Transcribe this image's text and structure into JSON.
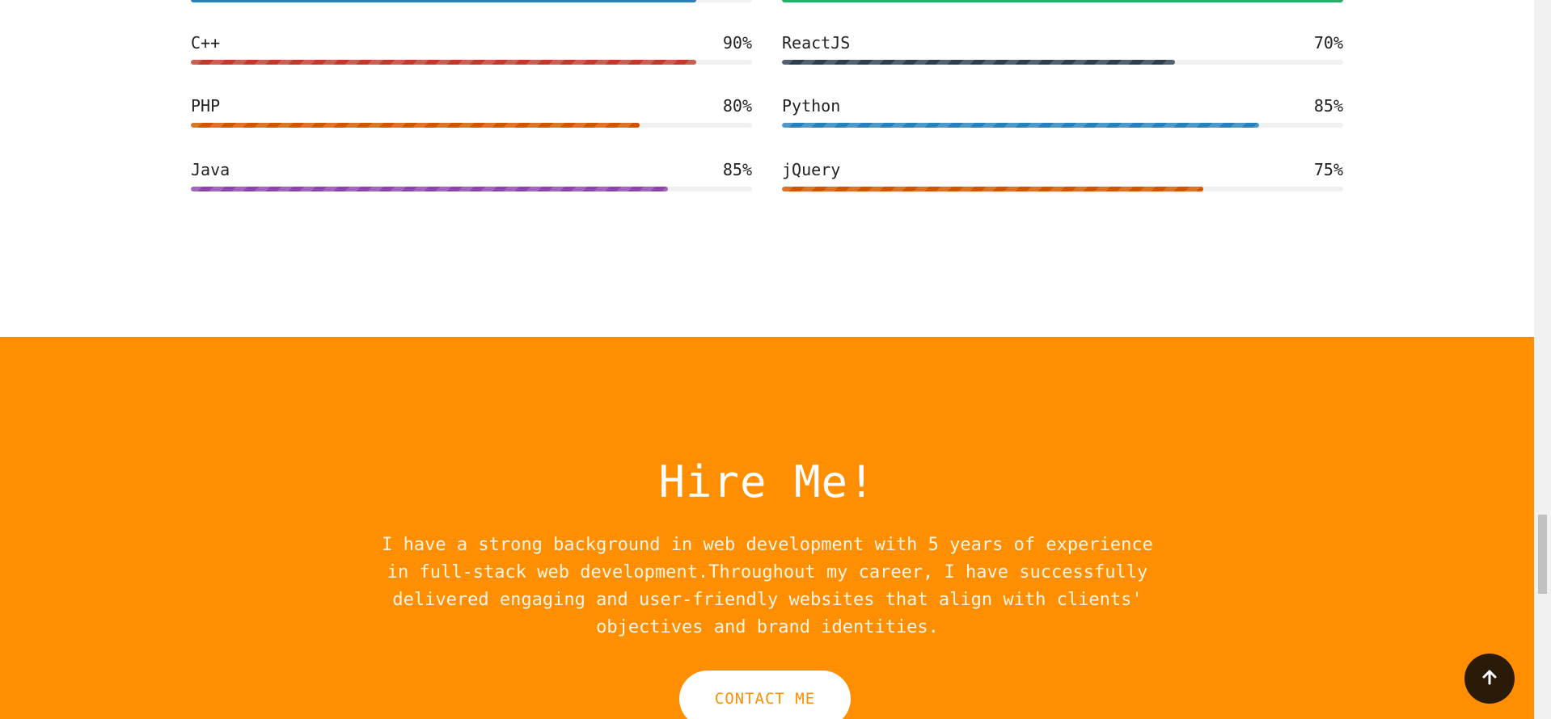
{
  "skills": {
    "left_column": [
      {
        "name": "C++",
        "percent": "90%",
        "level": 0.9,
        "color": "#c0392b"
      },
      {
        "name": "PHP",
        "percent": "80%",
        "level": 0.8,
        "color": "#d35400"
      },
      {
        "name": "Java",
        "percent": "85%",
        "level": 0.85,
        "color": "#8e44ad"
      }
    ],
    "right_column": [
      {
        "name": "ReactJS",
        "percent": "70%",
        "level": 0.7,
        "color": "#2c3e50"
      },
      {
        "name": "Python",
        "percent": "85%",
        "level": 0.85,
        "color": "#2980b9"
      },
      {
        "name": "jQuery",
        "percent": "75%",
        "level": 0.75,
        "color": "#d35400"
      }
    ],
    "partial_top_left": {
      "level": 0.9,
      "color": "#2980b9"
    },
    "partial_top_right": {
      "level": 1.0,
      "color": "#27ae60"
    }
  },
  "hire": {
    "title": "Hire Me!",
    "description": "I have a strong background in web development with 5 years of experience in full-stack web development.Throughout my career, I have successfully delivered engaging and user-friendly websites that align with clients' objectives and brand identities.",
    "contact_label": "CONTACT ME",
    "background_color": "#ff8f00"
  },
  "scroll_to_top_icon": "arrow-up-icon"
}
